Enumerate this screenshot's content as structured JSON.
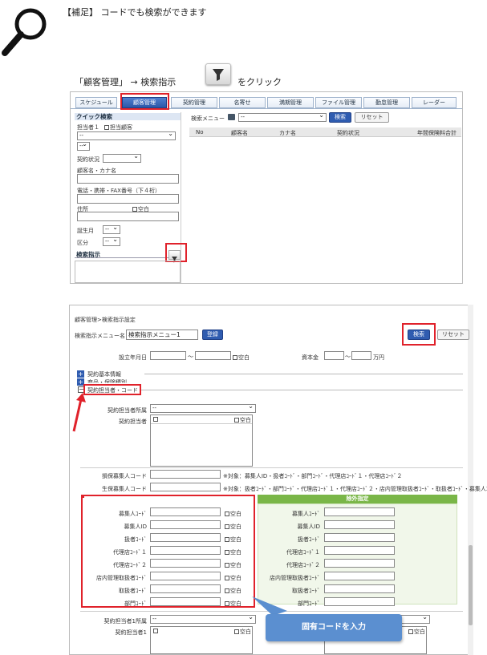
{
  "note": {
    "title": "【補足】 コードでも検索ができます",
    "instruction_prefix": "「顧客管理」 → 検索指示",
    "instruction_suffix": "をクリック"
  },
  "screen1": {
    "tabs": [
      "スケジュール",
      "顧客管理",
      "契約管理",
      "名寄せ",
      "満期管理",
      "ファイル管理",
      "勤怠管理",
      "レーダー"
    ],
    "quick_search": {
      "header": "クイック検索",
      "owner_label": "担当者１",
      "owner_check": "担当顧客",
      "owner_select": "--",
      "owner_select2": "--",
      "contract_status_label": "契約状況",
      "name_label": "顧客名・カナ名",
      "phone_label": "電話・携帯・FAX番号（下４桁）",
      "address_label": "住所",
      "blank": "空白",
      "birth_month_label": "誕生月",
      "birth_month_value": "--",
      "category_label": "区分",
      "category_value": "--",
      "search_instruction": "検索指示"
    },
    "search_menu_label": "検索メニュー",
    "search_menu_value": "--",
    "search_button": "検索",
    "reset_button": "リセット",
    "columns": [
      "No",
      "顧客名",
      "カナ名",
      "契約状況",
      "年間保険料合計"
    ]
  },
  "screen2": {
    "breadcrumb": "顧客管理>検索指示設定",
    "menu_name_label": "検索指示メニュー名",
    "menu_name_value": "検索指示メニュー1",
    "register_button": "登録",
    "search_button": "検索",
    "reset_button": "リセット",
    "est_label": "設立年月日",
    "tilde": "〜",
    "blank": "空白",
    "capital_label": "資本金",
    "capital_unit": "万円",
    "sections": [
      "契約基本情報",
      "商品・保険種別",
      "契約担当者・コード"
    ],
    "branch_label": "契約担当者所属",
    "branch_value": "--",
    "owner_label": "契約担当者",
    "damage_agent_label": "損保募集人コード",
    "damage_agent_note": "※対象：募集人ID・扱者ｺｰﾄﾞ・部門ｺｰﾄﾞ・代理店ｺｰﾄﾞ１・代理店ｺｰﾄﾞ２",
    "life_agent_label": "生保募集人コード",
    "life_agent_note": "※対象：扱者ｺｰﾄﾞ・部門ｺｰﾄﾞ・代理店ｺｰﾄﾞ１・代理店ｺｰﾄﾞ２・店内管理取扱者ｺｰﾄﾞ・取扱者ｺｰﾄﾞ・募集人ｺｰﾄﾞ",
    "exclusion_header": "除外指定",
    "code_fields": [
      "募集人ｺｰﾄﾞ",
      "募集人ID",
      "扱者ｺｰﾄﾞ",
      "代理店ｺｰﾄﾞ１",
      "代理店ｺｰﾄﾞ２",
      "店内管理取扱者ｺｰﾄﾞ",
      "取扱者ｺｰﾄﾞ",
      "部門ｺｰﾄﾞ"
    ],
    "branch1_label": "契約担当者1所属",
    "branch1_value": "--",
    "owner1_label": "契約担当者1",
    "callout": "固有コードを入力"
  },
  "colors": {
    "accent_red": "#e0222b",
    "brand_blue": "#2f5cb0",
    "callout_blue": "#5b8fd0",
    "green_header": "#7ab648"
  },
  "icons": [
    "search-magnifier-icon",
    "filter-funnel-icon",
    "plus-icon",
    "minus-icon",
    "red-arrow-icon"
  ]
}
